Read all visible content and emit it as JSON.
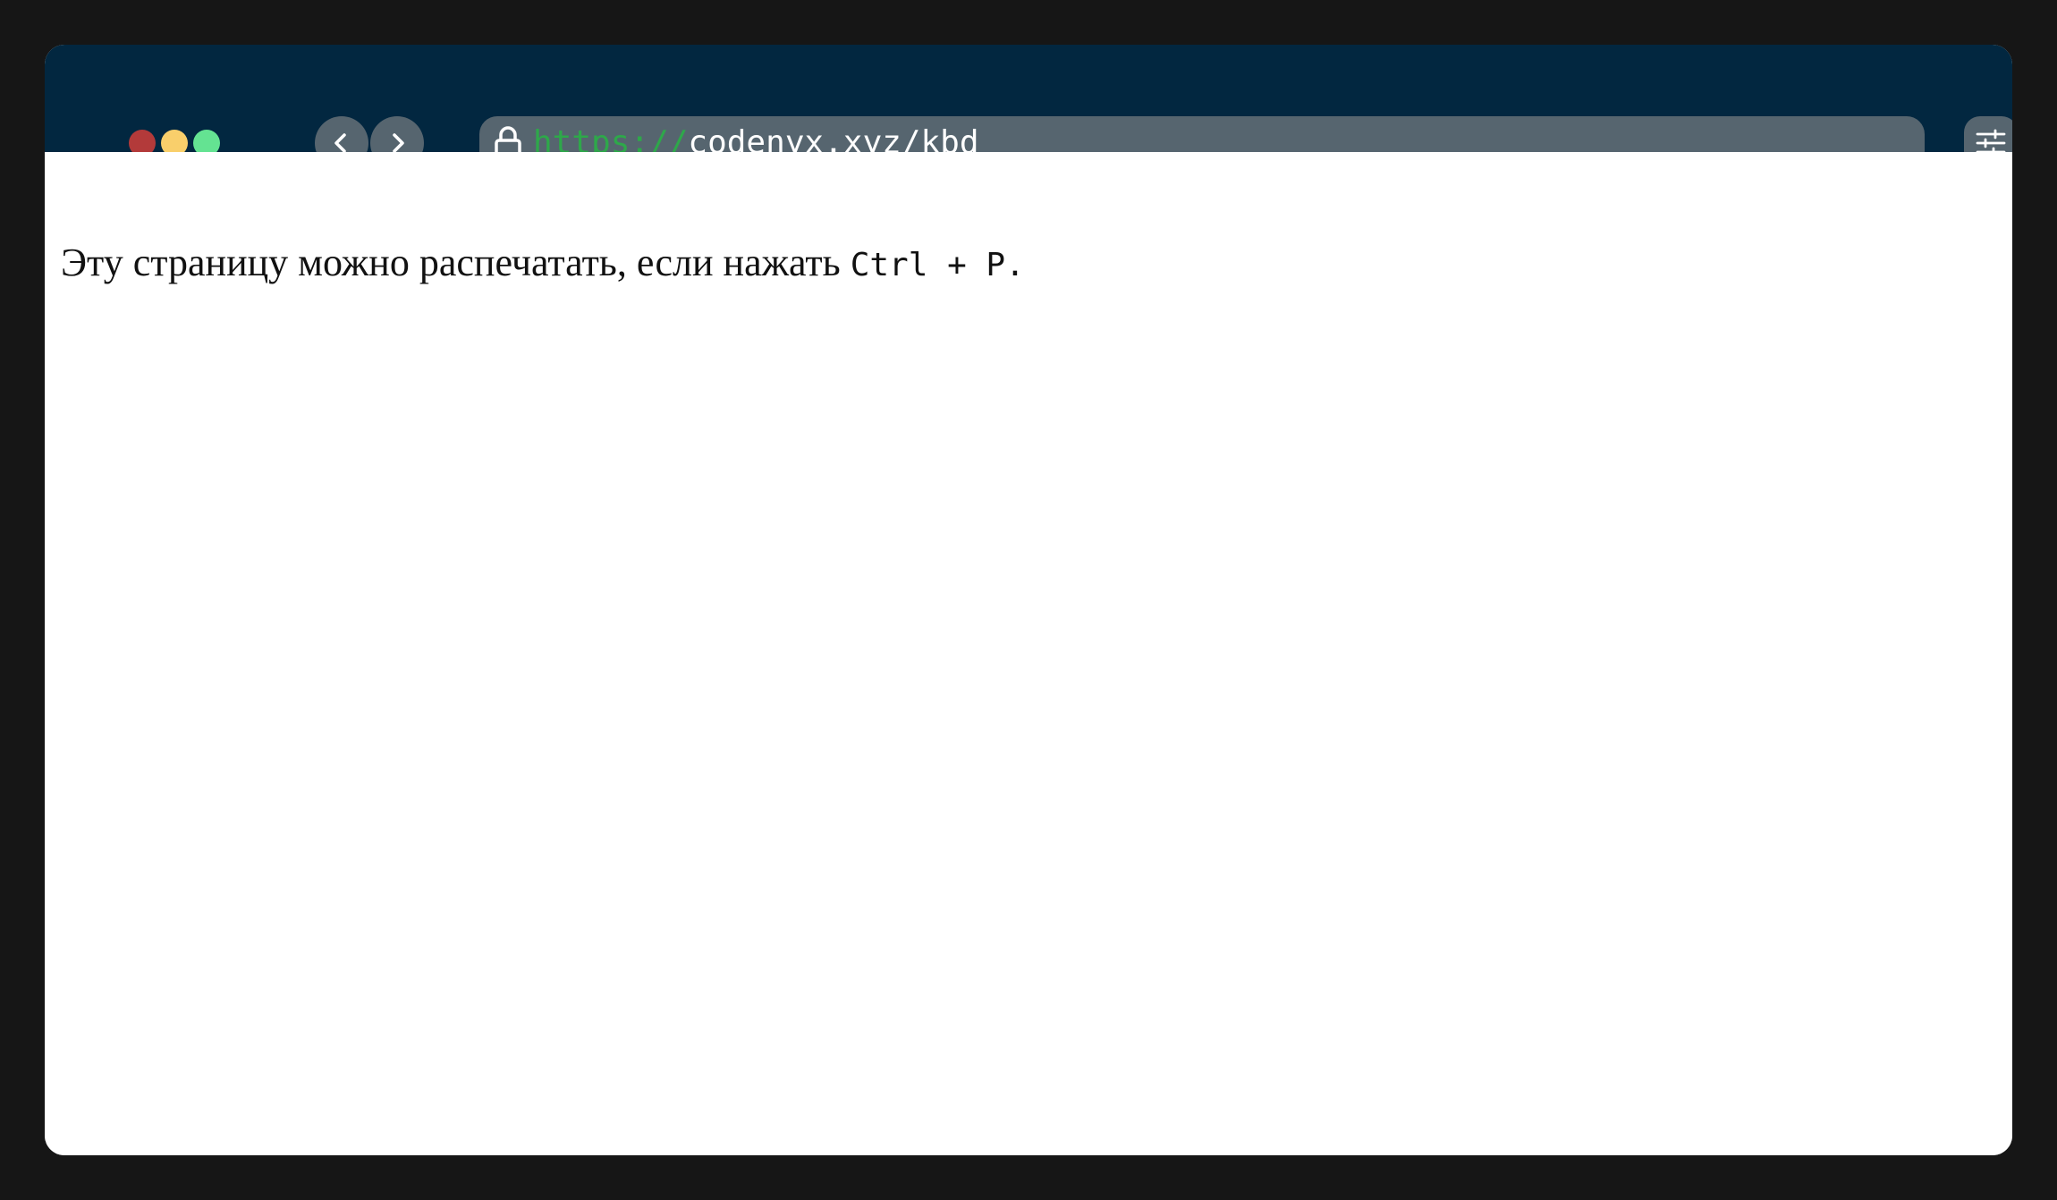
{
  "browser": {
    "address_bar": {
      "scheme": "https://",
      "host_path": "codenyx.xyz/kbd"
    },
    "icons": {
      "lock": "lock-icon",
      "back": "chevron-left-icon",
      "forward": "chevron-right-icon",
      "settings": "sliders-icon"
    },
    "colors": {
      "titlebar": "#022740",
      "control_bg": "#56656f",
      "scheme_text": "#2ea84a",
      "traffic_red": "#b33a3a",
      "traffic_yellow": "#f9cf6b",
      "traffic_green": "#64e392"
    }
  },
  "page": {
    "text_before": "Эту страницу можно распечатать, если нажать ",
    "key_1": "Ctrl",
    "separator": " + ",
    "key_2": "P",
    "text_after": "."
  }
}
